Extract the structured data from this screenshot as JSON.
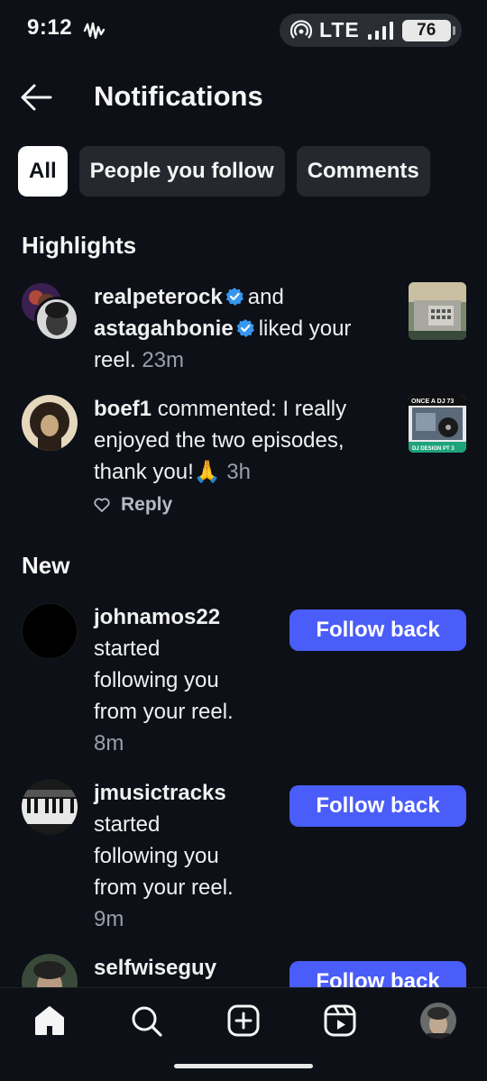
{
  "status_bar": {
    "time": "9:12",
    "network": "LTE",
    "battery": "76"
  },
  "header": {
    "title": "Notifications"
  },
  "tabs": [
    {
      "label": "All",
      "active": true
    },
    {
      "label": "People you follow",
      "active": false
    },
    {
      "label": "Comments",
      "active": false
    }
  ],
  "sections": {
    "highlights": "Highlights",
    "new": "New"
  },
  "highlights": [
    {
      "user1": "realpeterock",
      "connector": "and",
      "user2": "astagahbonie",
      "action": "liked your",
      "action2": "reel.",
      "time": "23m"
    },
    {
      "user": "boef1",
      "line1": "commented: I really",
      "line2": "enjoyed the two episodes,",
      "line3": "thank you!🙏",
      "time": "3h",
      "reply_label": "Reply",
      "thumb_text": "ONCE A DJ 73",
      "thumb_text2": "DJ DESIGN PT 3"
    }
  ],
  "new_items": [
    {
      "user": "johnamos22",
      "lines": [
        "started",
        "following you",
        "from your reel."
      ],
      "time": "8m",
      "button": "Follow back"
    },
    {
      "user": "jmusictracks",
      "lines": [
        "started",
        "following you",
        "from your reel."
      ],
      "time": "9m",
      "button": "Follow back"
    },
    {
      "user": "selfwiseguy",
      "button": "Follow back"
    }
  ],
  "colors": {
    "background": "#0d1017",
    "accent": "#4a5df9",
    "verified": "#3797f0"
  },
  "nav_icons": [
    "home-icon",
    "search-icon",
    "create-icon",
    "reels-icon",
    "profile-avatar"
  ]
}
